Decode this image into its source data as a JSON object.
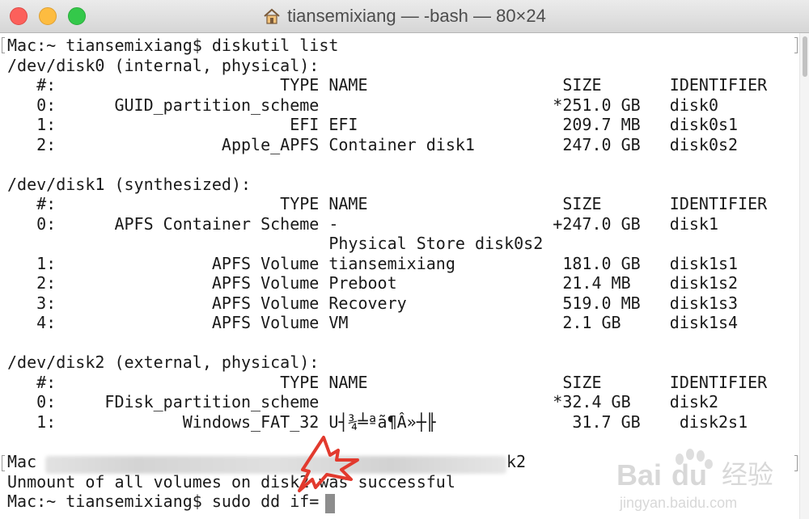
{
  "window": {
    "title": "tiansemixiang — -bash — 80×24",
    "title_icon": "home-icon"
  },
  "terminal": {
    "lines": [
      "Mac:~ tiansemixiang$ diskutil list",
      "/dev/disk0 (internal, physical):",
      "   #:                       TYPE NAME                    SIZE       IDENTIFIER",
      "   0:      GUID_partition_scheme                        *251.0 GB   disk0",
      "   1:                        EFI EFI                     209.7 MB   disk0s1",
      "   2:                 Apple_APFS Container disk1         247.0 GB   disk0s2",
      "",
      "/dev/disk1 (synthesized):",
      "   #:                       TYPE NAME                    SIZE       IDENTIFIER",
      "   0:      APFS Container Scheme -                      +247.0 GB   disk1",
      "                                 Physical Store disk0s2",
      "   1:                APFS Volume tiansemixiang           181.0 GB   disk1s1",
      "   2:                APFS Volume Preboot                 21.4 MB    disk1s2",
      "   3:                APFS Volume Recovery                519.0 MB   disk1s3",
      "   4:                APFS Volume VM                      2.1 GB     disk1s4",
      "",
      "/dev/disk2 (external, physical):",
      "   #:                       TYPE NAME                    SIZE       IDENTIFIER",
      "   0:     FDisk_partition_scheme                        *32.4 GB    disk2",
      "   1:             Windows_FAT_32 U┤¾╧ªã¶Â»┼╟              31.7 GB    disk2s1",
      "",
      "Mac",
      "Unmount of all volumes on disk2 was successful",
      "Mac:~ tiansemixiang$ sudo dd if="
    ],
    "redacted_line_tail": "k2"
  },
  "watermark": {
    "brand": "Bai",
    "brand2": "du",
    "cn": "经验",
    "url": "jingyan.baidu.com"
  }
}
